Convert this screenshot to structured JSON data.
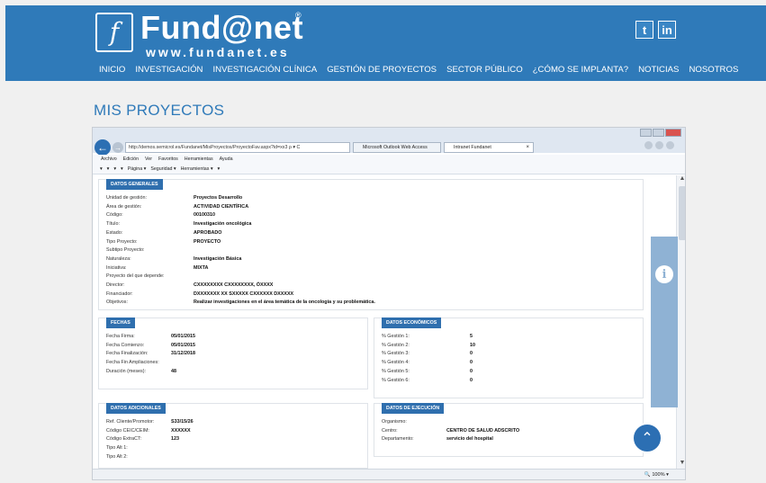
{
  "site": {
    "logo_letter": "f",
    "brand": "Fund@net",
    "reg": "®",
    "url": "www.fundanet.es",
    "social": {
      "twitter": "t",
      "linkedin": "in"
    },
    "nav": [
      "INICIO",
      "INVESTIGACIÓN",
      "INVESTIGACIÓN CLÍNICA",
      "GESTIÓN DE PROYECTOS",
      "SECTOR PÚBLICO",
      "¿CÓMO SE IMPLANTA?",
      "NOTICIAS",
      "NOSOTROS"
    ],
    "page_title": "MIS PROYECTOS"
  },
  "browser": {
    "address": "http://demos.semicrol.es/Fundanet/MisProyectos/ProyectoFav.aspx?id=xx3",
    "address_icons": "ρ ▾ C",
    "tabs": [
      {
        "label": "Microsoft Outlook Web Access"
      },
      {
        "label": "Intranet Fundanet"
      }
    ],
    "tab_close": "×",
    "menu": [
      "Archivo",
      "Edición",
      "Ver",
      "Favoritos",
      "Herramientas",
      "Ayuda"
    ],
    "toolbar": [
      "▾",
      "▾",
      "▾",
      "▾",
      "Página ▾",
      "Seguridad ▾",
      "Herramientas ▾",
      "▾"
    ],
    "zoom": "100%",
    "zoom_prefix": "🔍"
  },
  "panels": {
    "generales": {
      "title": "DATOS GENERALES",
      "rows": [
        {
          "k": "Unidad de gestión:",
          "v": "Proyectos Desarrollo"
        },
        {
          "k": "Área de gestión:",
          "v": "ACTIVIDAD CIENTÍFICA"
        },
        {
          "k": "Código:",
          "v": "00100310"
        },
        {
          "k": "Título:",
          "v": "Investigación oncológica"
        },
        {
          "k": "Estado:",
          "v": "APROBADO"
        },
        {
          "k": "Tipo Proyecto:",
          "v": "PROYECTO"
        },
        {
          "k": "Subtipo Proyecto:",
          "v": ""
        },
        {
          "k": "Naturaleza:",
          "v": "Investigación Básica"
        },
        {
          "k": "Iniciativa:",
          "v": "MIXTA"
        },
        {
          "k": "Proyecto del que depende:",
          "v": ""
        },
        {
          "k": "Director:",
          "v": "CXXXXXXXX CXXXXXXXX, ÓXXXX"
        },
        {
          "k": "Financiador:",
          "v": "DXXXXXXX XX SXXXXX CXXXXXX DXXXXX"
        },
        {
          "k": "Objetivos:",
          "v": "Realizar investigaciones en el área temática de la oncología y su problemática."
        }
      ]
    },
    "fechas": {
      "title": "FECHAS",
      "rows": [
        {
          "k": "Fecha Firma:",
          "v": "05/01/2015"
        },
        {
          "k": "Fecha Comienzo:",
          "v": "05/01/2015"
        },
        {
          "k": "Fecha Finalización:",
          "v": "31/12/2018"
        },
        {
          "k": "Fecha Fin Ampliaciones:",
          "v": ""
        },
        {
          "k": "Duración (meses):",
          "v": "48"
        }
      ]
    },
    "economicos": {
      "title": "DATOS ECONÓMICOS",
      "rows": [
        {
          "k": "% Gestión 1:",
          "v": "5"
        },
        {
          "k": "% Gestión 2:",
          "v": "10"
        },
        {
          "k": "% Gestión 3:",
          "v": "0"
        },
        {
          "k": "% Gestión 4:",
          "v": "0"
        },
        {
          "k": "% Gestión 5:",
          "v": "0"
        },
        {
          "k": "% Gestión 6:",
          "v": "0"
        }
      ]
    },
    "adicionales": {
      "title": "DATOS ADICIONALES",
      "rows": [
        {
          "k": "Ref. Cliente/Promotor:",
          "v": "S33/15/26"
        },
        {
          "k": "Código CEIC/CEIM:",
          "v": "XXXXXX"
        },
        {
          "k": "Código ExtraCT:",
          "v": "123"
        },
        {
          "k": "Tipo Alt 1:",
          "v": ""
        },
        {
          "k": "Tipo Alt 2:",
          "v": ""
        }
      ]
    },
    "ejecucion": {
      "title": "DATOS DE EJECUCIÓN",
      "rows": [
        {
          "k": "Organismo:",
          "v": ""
        },
        {
          "k": "Centro:",
          "v": "CENTRO DE SALUD ADSCRITO"
        },
        {
          "k": "Departamento:",
          "v": "servicio del hospital"
        }
      ]
    }
  },
  "widgets": {
    "info": "i",
    "up": "⌃"
  }
}
